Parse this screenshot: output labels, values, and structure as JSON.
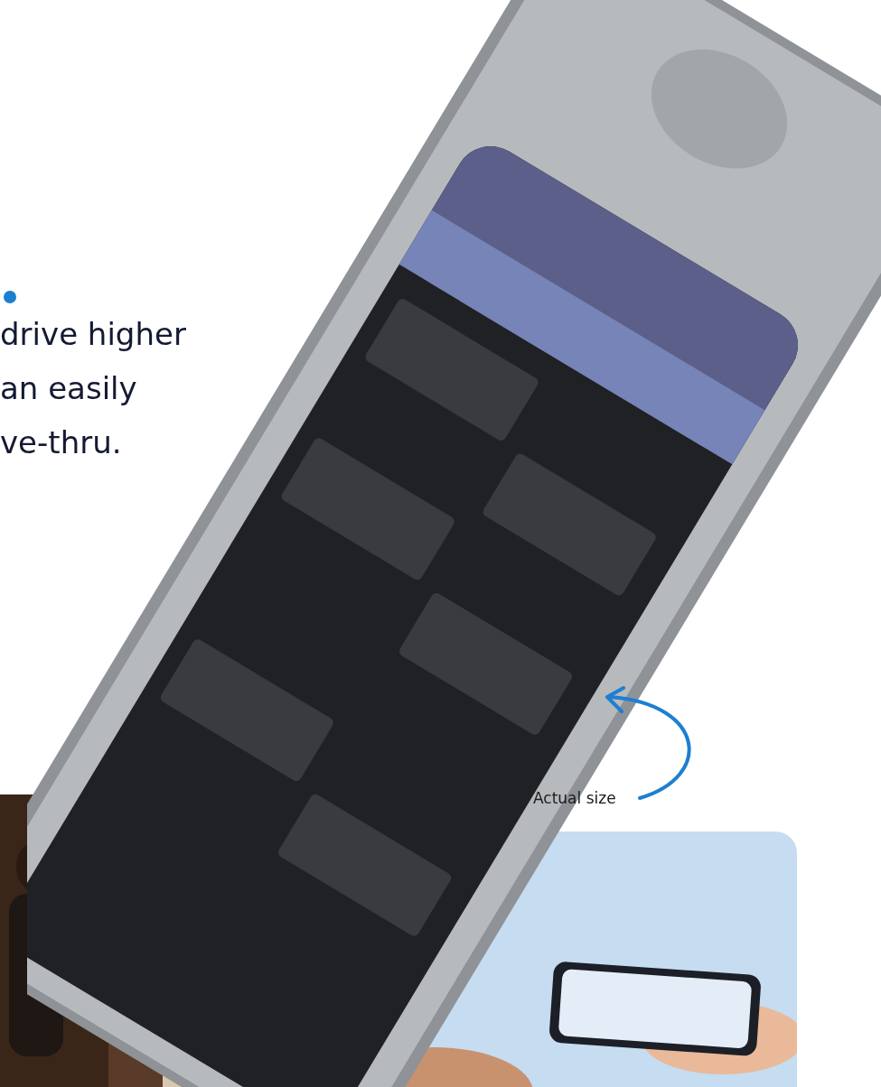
{
  "heading_lines": [
    "drive higher",
    "an easily",
    "ve-thru."
  ],
  "caption": "Actual size"
}
